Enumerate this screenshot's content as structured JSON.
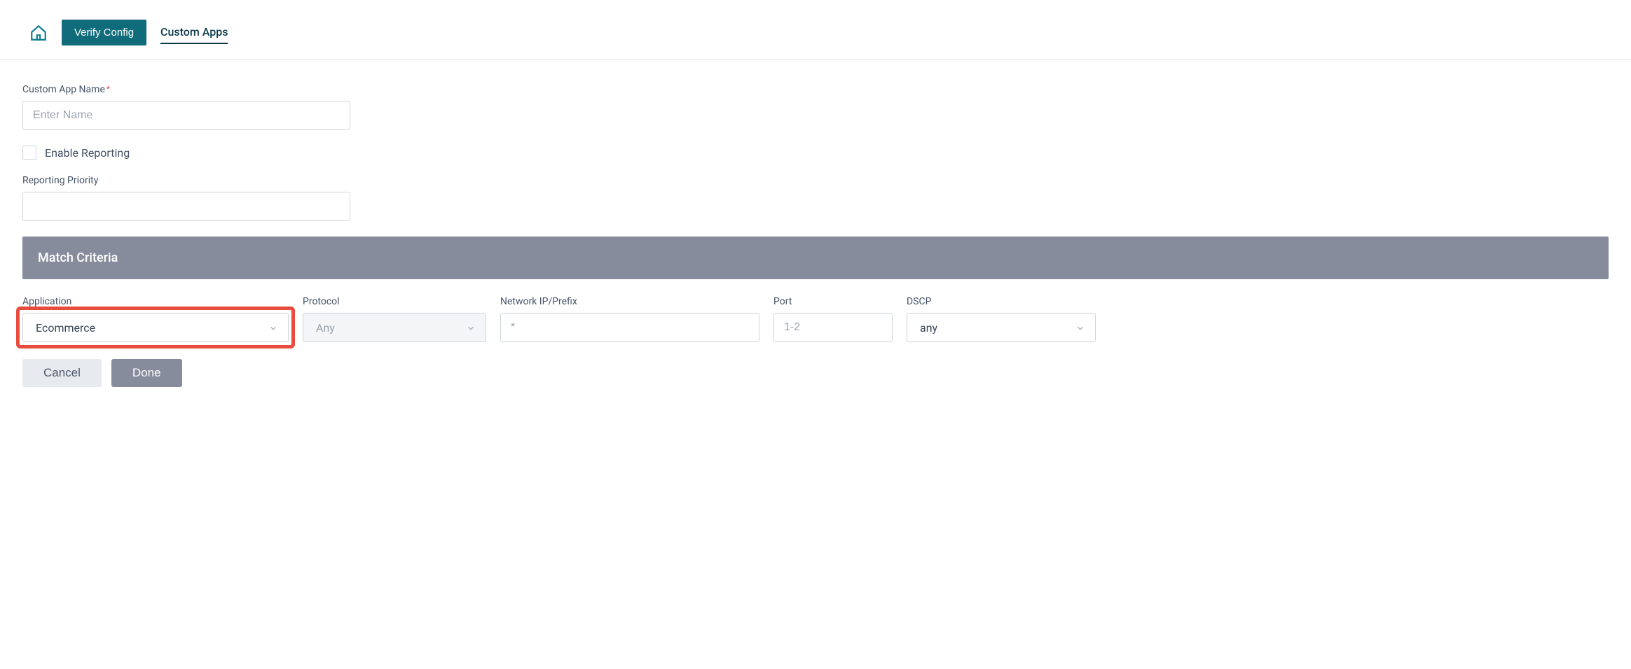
{
  "header": {
    "verify_label": "Verify Config",
    "tab_custom_apps": "Custom Apps"
  },
  "form": {
    "app_name_label": "Custom App Name",
    "app_name_placeholder": "Enter Name",
    "enable_reporting_label": "Enable Reporting",
    "reporting_priority_label": "Reporting Priority"
  },
  "section": {
    "match_criteria_title": "Match Criteria"
  },
  "criteria": {
    "application": {
      "label": "Application",
      "value": "Ecommerce"
    },
    "protocol": {
      "label": "Protocol",
      "value": "Any"
    },
    "network": {
      "label": "Network IP/Prefix",
      "placeholder": "*"
    },
    "port": {
      "label": "Port",
      "placeholder": "1-2"
    },
    "dscp": {
      "label": "DSCP",
      "value": "any"
    }
  },
  "actions": {
    "cancel": "Cancel",
    "done": "Done"
  }
}
